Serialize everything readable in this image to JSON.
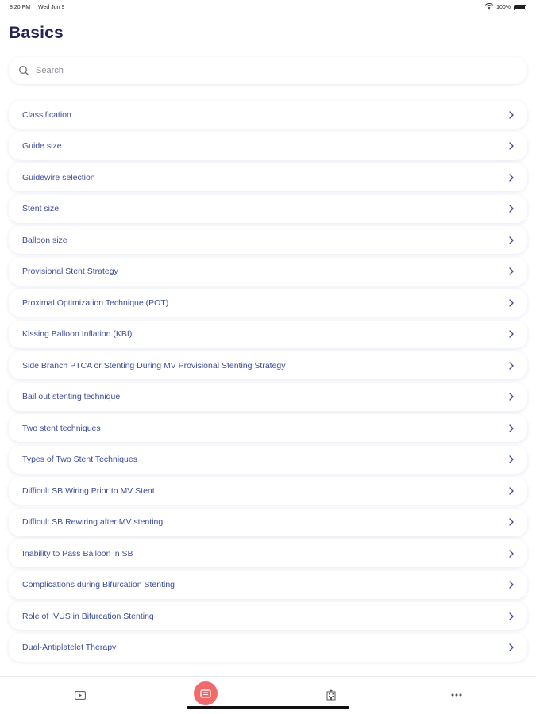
{
  "status_bar": {
    "time": "8:20 PM",
    "date": "Wed Jun 9",
    "battery": "100%"
  },
  "page": {
    "title": "Basics"
  },
  "search": {
    "placeholder": "Search"
  },
  "topics": [
    "Classification",
    "Guide size",
    "Guidewire selection",
    "Stent size",
    "Balloon size",
    "Provisional Stent Strategy",
    "Proximal Optimization Technique (POT)",
    "Kissing Balloon Inflation (KBI)",
    "Side Branch PTCA or Stenting During MV Provisional Stenting Strategy",
    "Bail out stenting technique",
    "Two stent techniques",
    "Types of Two Stent Techniques",
    "Difficult SB Wiring Prior to MV Stent",
    "Difficult SB Rewiring after MV stenting",
    "Inability to Pass Balloon in SB",
    "Complications during Bifurcation Stenting",
    "Role of IVUS in Bifurcation Stenting",
    "Dual-Antiplatelet Therapy"
  ],
  "tab_bar": {
    "tabs": [
      {
        "icon": "video-icon",
        "active": false
      },
      {
        "icon": "book-icon",
        "active": true
      },
      {
        "icon": "hospital-icon",
        "active": false
      },
      {
        "icon": "more-icon",
        "active": false
      }
    ],
    "active_color": "#f06a6a"
  },
  "colors": {
    "title": "#23245c",
    "row_text": "#3c4c9a",
    "chevron": "#3c4c9a"
  }
}
